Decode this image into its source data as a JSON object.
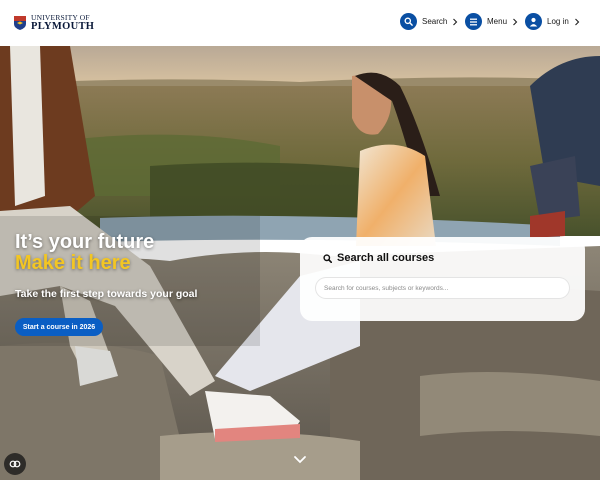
{
  "header": {
    "logo_line1": "UNIVERSITY OF",
    "logo_line2": "PLYMOUTH",
    "nav": {
      "search_label": "Search",
      "menu_label": "Menu",
      "login_label": "Log in"
    }
  },
  "hero": {
    "title_line1": "It’s your future",
    "title_line2": "Make it here",
    "subtitle": "Take the first step towards your goal",
    "cta_label": "Start a course in 2026"
  },
  "course_search": {
    "title": "Search all courses",
    "placeholder": "Search for courses, subjects or keywords..."
  },
  "colors": {
    "brand_blue": "#0a4fa3",
    "cta_blue": "#0a5ec4",
    "accent_yellow": "#f3c623"
  },
  "icons": [
    "university-crest-icon",
    "search-icon",
    "menu-icon",
    "user-icon",
    "chevron-right-icon",
    "chevron-down-icon",
    "cookie-settings-icon"
  ]
}
